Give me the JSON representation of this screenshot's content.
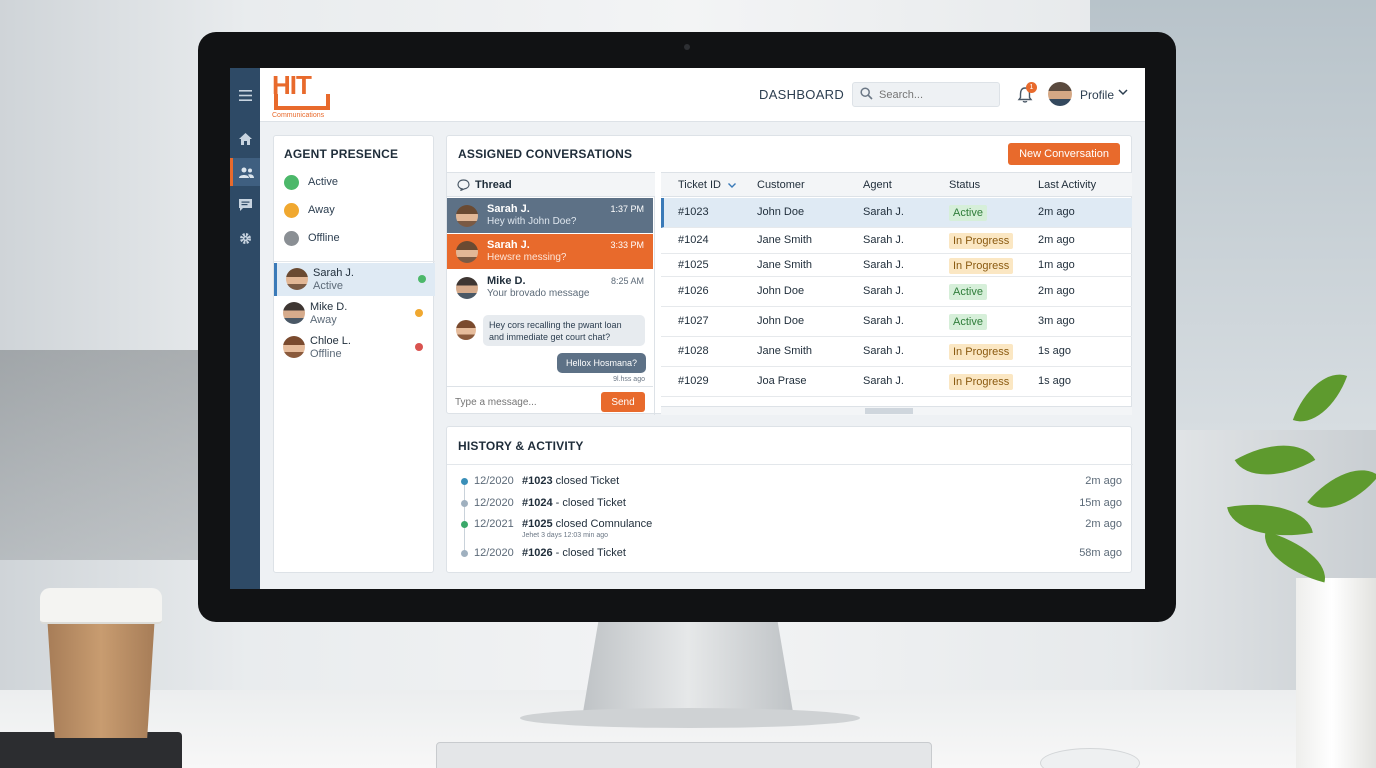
{
  "brand": {
    "logo_text": "HIT",
    "logo_sub": "Communications",
    "accent": "#e86a2c",
    "nav_bg": "#2e4a66"
  },
  "topbar": {
    "title": "DASHBOARD",
    "search_placeholder": "Search...",
    "notification_count": "1",
    "profile_label": "Profile"
  },
  "rail": {
    "icons": [
      "menu-icon",
      "home-icon",
      "users-icon",
      "chat-icon",
      "gear-icon"
    ]
  },
  "presence": {
    "title": "AGENT PRESENCE",
    "legend": [
      {
        "label": "Active",
        "color": "#4cb86a"
      },
      {
        "label": "Away",
        "color": "#f0a830"
      },
      {
        "label": "Offline",
        "color": "#8a8f94"
      }
    ],
    "agents": [
      {
        "name": "Sarah J.",
        "status": "Active",
        "dot": "#4cb86a"
      },
      {
        "name": "Mike D.",
        "status": "Away",
        "dot": "#f0a830"
      },
      {
        "name": "Chloe L.",
        "status": "Offline",
        "dot": "#d9534f"
      }
    ]
  },
  "assigned": {
    "title": "ASSIGNED CONVERSATIONS",
    "new_button": "New Conversation",
    "thread": {
      "header": "Thread",
      "messages": [
        {
          "name": "Sarah J.",
          "preview": "Hey with John Doe?",
          "time": "1:37 PM"
        },
        {
          "name": "Sarah J.",
          "preview": "Hewsre messing?",
          "time": "3:33 PM"
        },
        {
          "name": "Mike D.",
          "preview": "Your brovado message",
          "time": "8:25 AM"
        }
      ],
      "incoming_bubble": "Hey cors recalling the pwant loan and immediate get court chat?",
      "outgoing_bubble": "Hellox Hosmana?",
      "outgoing_time": "9l.hss ago",
      "composer_placeholder": "Type a message...",
      "send_label": "Send"
    },
    "table": {
      "columns": [
        "Ticket ID",
        "Customer",
        "Agent",
        "Status",
        "Last Activity"
      ],
      "rows": [
        {
          "id": "#1023",
          "customer": "John Doe",
          "agent": "Sarah J.",
          "status": "Active",
          "last": "2m ago"
        },
        {
          "id": "#1024",
          "customer": "Jane Smith",
          "agent": "Sarah J.",
          "status": "In Progress",
          "last": "2m ago"
        },
        {
          "id": "#1025",
          "customer": "Jane Smith",
          "agent": "Sarah J.",
          "status": "In Progress",
          "last": "1m ago"
        },
        {
          "id": "#1026",
          "customer": "John Doe",
          "agent": "Sarah J.",
          "status": "Active",
          "last": "2m ago"
        },
        {
          "id": "#1027",
          "customer": "John Doe",
          "agent": "Sarah J.",
          "status": "Active",
          "last": "3m ago"
        },
        {
          "id": "#1028",
          "customer": "Jane Smith",
          "agent": "Sarah J.",
          "status": "In Progress",
          "last": "1s ago"
        },
        {
          "id": "#1029",
          "customer": "Joa Prase",
          "agent": "Sarah J.",
          "status": "In Progress",
          "last": "1s ago"
        }
      ]
    }
  },
  "history": {
    "title": "HISTORY & ACTIVITY",
    "items": [
      {
        "date": "12/2020",
        "text": "#1023 closed Ticket",
        "sub": "",
        "ago": "2m ago",
        "dot": "#3a8fb8"
      },
      {
        "date": "12/2020",
        "text": "#1024 - closed Ticket",
        "sub": "",
        "ago": "15m ago",
        "dot": "#9fb0bf"
      },
      {
        "date": "12/2021",
        "text": "#1025 closed Comnulance",
        "sub": "Jehet 3 days 12:03 min ago",
        "ago": "2m ago",
        "dot": "#3aa86a"
      },
      {
        "date": "12/2020",
        "text": "#1026 - closed Ticket",
        "sub": "",
        "ago": "58m ago",
        "dot": "#9fb0bf"
      }
    ]
  }
}
